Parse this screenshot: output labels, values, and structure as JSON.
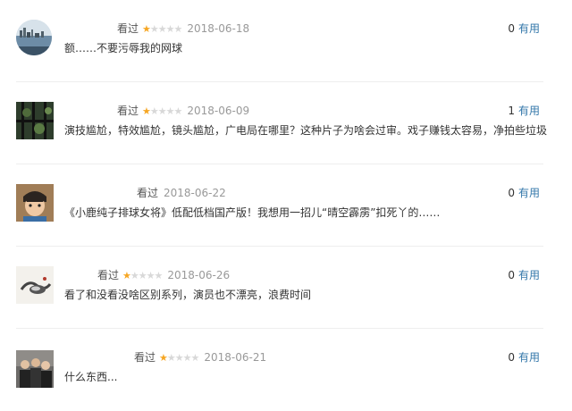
{
  "reviews": [
    {
      "status": "看过",
      "rating": 1,
      "max_rating": 5,
      "date": "2018-06-18",
      "useful_count": "0",
      "useful_label": "有用",
      "content": "额……不要污辱我的网球"
    },
    {
      "status": "看过",
      "rating": 1,
      "max_rating": 5,
      "date": "2018-06-09",
      "useful_count": "1",
      "useful_label": "有用",
      "content": "演技尴尬，特效尴尬，镜头尴尬，广电局在哪里？这种片子为啥会过审。戏子赚钱太容易，净拍些垃圾"
    },
    {
      "status": "看过",
      "rating": 0,
      "max_rating": 5,
      "date": "2018-06-22",
      "useful_count": "0",
      "useful_label": "有用",
      "content": "《小鹿纯子排球女将》低配低档国产版！我想用一招儿“晴空霹雳”扣死丫的……"
    },
    {
      "status": "看过",
      "rating": 1,
      "max_rating": 5,
      "date": "2018-06-26",
      "useful_count": "0",
      "useful_label": "有用",
      "content": "看了和没看没啥区别系列，演员也不漂亮，浪费时间"
    },
    {
      "status": "看过",
      "rating": 1,
      "max_rating": 5,
      "date": "2018-06-21",
      "useful_count": "0",
      "useful_label": "有用",
      "content": "什么东西..."
    }
  ],
  "colors": {
    "star_on": "#f6a623",
    "star_off": "#d8d8d8",
    "link": "#3377aa",
    "date": "#999999"
  },
  "avatar_icons": [
    "seaside-city-avatar-icon",
    "window-plant-avatar-icon",
    "anime-boy-avatar-icon",
    "ink-painting-avatar-icon",
    "group-photo-avatar-icon"
  ]
}
